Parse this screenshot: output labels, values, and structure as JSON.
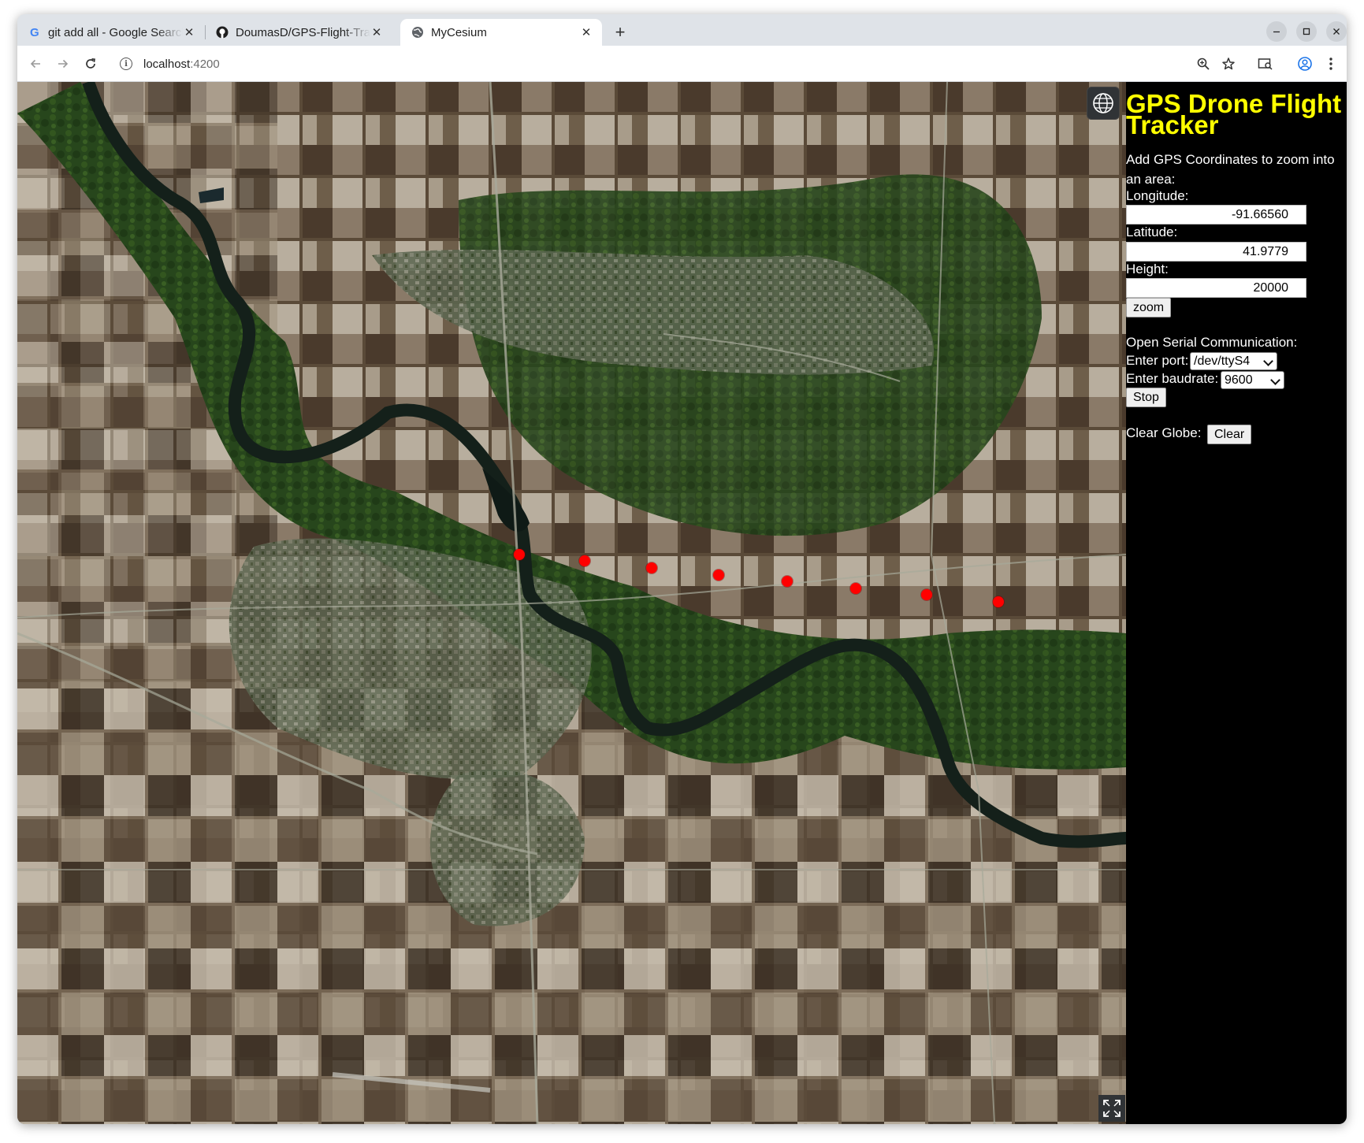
{
  "browser": {
    "tabs": [
      {
        "title": "git add all - Google Search",
        "icon": "google-icon",
        "active": false
      },
      {
        "title": "DoumasD/GPS-Flight-Tracker",
        "icon": "github-icon",
        "active": false
      },
      {
        "title": "MyCesium",
        "icon": "globe-icon",
        "active": true
      }
    ],
    "url_host": "localhost",
    "url_port": ":4200"
  },
  "app": {
    "title": "GPS Drone Flight Tracker",
    "intro": "Add GPS Coordinates to zoom into an area:",
    "longitude_label": "Longitude:",
    "longitude_value": "-91.66560",
    "latitude_label": "Latitude:",
    "latitude_value": "41.9779",
    "height_label": "Height:",
    "height_value": "20000",
    "zoom_label": "zoom",
    "serial_heading": "Open Serial Communication:",
    "port_label": "Enter port:",
    "port_value": "/dev/ttyS4",
    "baud_label": "Enter baudrate:",
    "baud_value": "9600",
    "stop_label": "Stop",
    "clear_label": "Clear Globe:",
    "clear_button": "Clear"
  },
  "map": {
    "marker_color": "#ff0000",
    "point_count": 8
  }
}
